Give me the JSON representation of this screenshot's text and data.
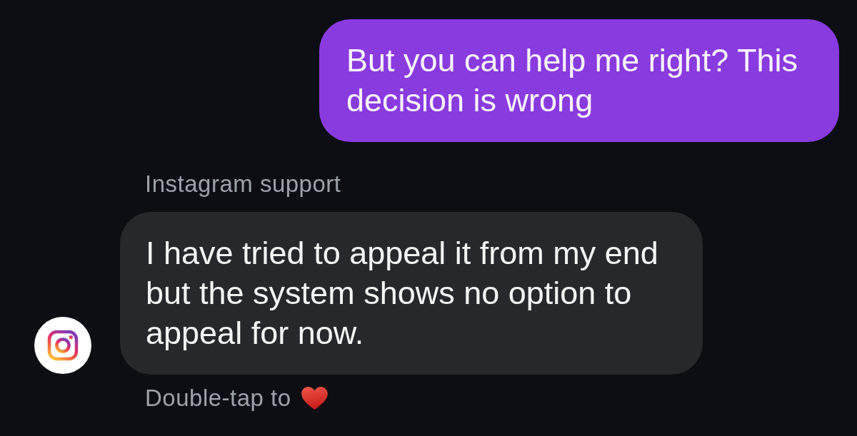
{
  "messages": [
    {
      "kind": "outgoing",
      "text": "But you can help me right? This decision is wrong"
    },
    {
      "kind": "incoming",
      "sender": "Instagram support",
      "text": "I have tried to appeal it from my end but the system shows no option to appeal for now."
    }
  ],
  "hint": {
    "text": "Double-tap to"
  }
}
